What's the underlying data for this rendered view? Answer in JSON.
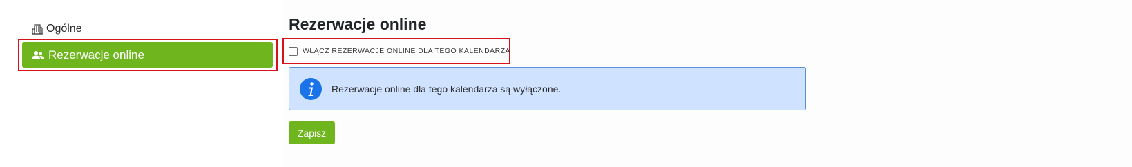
{
  "sidebar": {
    "items": [
      {
        "label": "Ogólne",
        "icon": "building-icon"
      },
      {
        "label": "Rezerwacje online",
        "icon": "users-icon",
        "active": true
      }
    ]
  },
  "main": {
    "title": "Rezerwacje online",
    "enable_checkbox": {
      "label": "WŁĄCZ REZERWACJE ONLINE DLA TEGO KALENDARZA",
      "checked": false
    },
    "alert": {
      "icon": "info-icon",
      "text": "Rezerwacje online dla tego kalendarza są wyłączone."
    },
    "save_label": "Zapisz"
  },
  "colors": {
    "accent_green": "#6fb51d",
    "highlight_red": "#d9111a",
    "info_blue": "#1a73e8",
    "alert_bg": "#cfe2ff"
  }
}
